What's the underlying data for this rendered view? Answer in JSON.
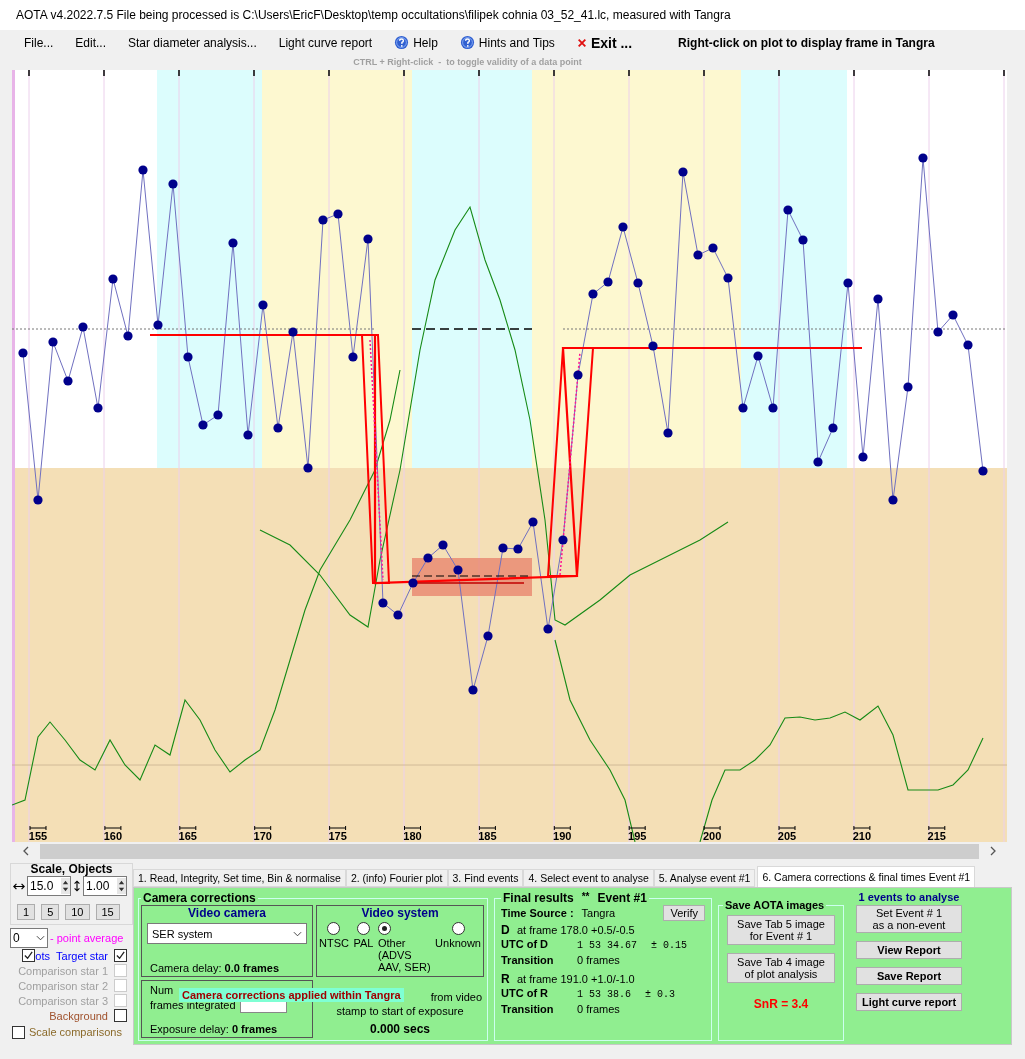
{
  "window": {
    "title": "AOTA v4.2022.7.5    File being processed is C:\\Users\\EricF\\Desktop\\temp occultations\\filipek cohnia 03_52_41.lc, measured with Tangra"
  },
  "menu": [
    {
      "label": "File...",
      "kind": "plain"
    },
    {
      "label": "Edit...",
      "kind": "plain"
    },
    {
      "label": "Star diameter analysis...",
      "kind": "plain"
    },
    {
      "label": "Light curve report",
      "kind": "plain"
    },
    {
      "label": "Help",
      "kind": "help"
    },
    {
      "label": "Hints and Tips",
      "kind": "help"
    },
    {
      "label": "Exit ...",
      "kind": "exit"
    }
  ],
  "plot_hint": "Right-click on plot to display frame in Tangra",
  "ctrl_hint": "CTRL + Right-click  -  to toggle validity of a data point",
  "plot": {
    "x_tick_labels": [
      "155",
      "160",
      "165",
      "170",
      "175",
      "180",
      "185",
      "190",
      "195",
      "200",
      "205",
      "210",
      "215"
    ]
  },
  "left_panel": {
    "title": "Scale,  Objects",
    "h_scale": "15.0",
    "v_scale": "1.00",
    "zoom_buttons": [
      "1",
      "5",
      "10",
      "15"
    ],
    "average": "0",
    "average_label": "- point average",
    "dots_toggle": {
      "label": "ots",
      "checked": true
    },
    "objects": [
      {
        "label": "Target star",
        "checked": true,
        "disabled": false,
        "color": "#0000ff"
      },
      {
        "label": "Comparison star 1",
        "checked": false,
        "disabled": true,
        "color": "#a0a0a0"
      },
      {
        "label": "Comparison star 2",
        "checked": false,
        "disabled": true,
        "color": "#a0a0a0"
      },
      {
        "label": "Comparison star 3",
        "checked": false,
        "disabled": true,
        "color": "#a0a0a0"
      },
      {
        "label": "Background",
        "checked": false,
        "disabled": false,
        "color": "#a0522d"
      }
    ],
    "scale_comparisons": {
      "label": "Scale comparisons",
      "checked": false
    }
  },
  "tabs": [
    {
      "label": "1.  Read, Integrity, Set time, Bin & normalise",
      "selected": false
    },
    {
      "label": "2. (info)  Fourier plot",
      "selected": false
    },
    {
      "label": "3. Find events",
      "selected": false
    },
    {
      "label": "4. Select event to analyse",
      "selected": false
    },
    {
      "label": "5. Analyse event #1",
      "selected": false
    },
    {
      "label": "6. Camera corrections & final times Event #1",
      "selected": true
    }
  ],
  "camera_corrections": {
    "title": "Camera corrections",
    "video_camera": {
      "title": "Video camera",
      "camera": "SER system",
      "delay_label": "Camera delay:",
      "delay_value": "0.0 frames"
    },
    "video_system": {
      "title": "Video system",
      "options": [
        {
          "label": "NTSC",
          "selected": false
        },
        {
          "label": "PAL",
          "selected": false
        },
        {
          "label": "Other\n(ADVS\nAAV, SER)",
          "selected": true
        },
        {
          "label": "Unknown",
          "selected": false
        }
      ]
    },
    "integration": {
      "label_start": "Num",
      "label_end": "frames integrated",
      "exposure_label": "Exposure delay:",
      "exposure_value": "0 frames"
    },
    "offset": {
      "line1": "from video",
      "line2": "stamp to start of exposure",
      "value": "0.000 secs"
    },
    "tooltip": "Camera corrections applied within Tangra"
  },
  "final_results": {
    "title": "Final results",
    "marker": "**",
    "event": "Event #1",
    "verify": "Verify",
    "time_source_label": "Time Source :",
    "time_source": "Tangra",
    "events": [
      {
        "letter": "D",
        "frame": "at frame 178.0  +0.5/-0.5",
        "utc_label": "UTC of D",
        "utc": "1 53 34.67",
        "error": "± 0.15",
        "transition_label": "Transition",
        "transition": "0 frames"
      },
      {
        "letter": "R",
        "frame": "at frame 191.0  +1.0/-1.0",
        "utc_label": "UTC of R",
        "utc": "1 53 38.6",
        "error": "± 0.3",
        "transition_label": "Transition",
        "transition": "0 frames"
      }
    ]
  },
  "save_images": {
    "title": "Save AOTA images",
    "buttons": [
      "Save Tab 5 image\nfor Event # 1",
      "Save Tab 4 image\nof plot analysis"
    ],
    "snr": "SnR = 3.4"
  },
  "actions": {
    "events_count": "1  events to analyse",
    "non_event": "Set Event # 1\nas a non-event",
    "buttons": [
      "View Report",
      "Save Report",
      "Light curve report"
    ]
  }
}
